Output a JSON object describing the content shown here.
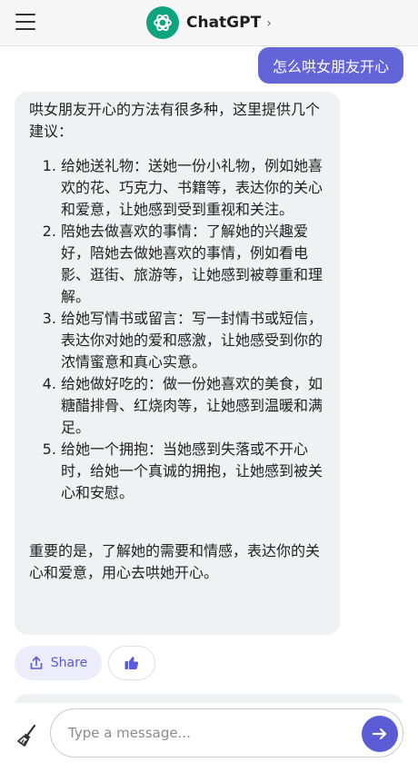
{
  "header": {
    "title": "ChatGPT",
    "chevron": "›",
    "menu_icon": "hamburger-menu-icon",
    "logo_icon": "openai-logo-icon",
    "logo_color": "#10a37f"
  },
  "user_message": "怎么哄女朋友开心",
  "assistant_message": {
    "intro": "哄女朋友开心的方法有很多种，这里提供几个建议：",
    "items": [
      "给她送礼物：送她一份小礼物，例如她喜欢的花、巧克力、书籍等，表达你的关心和爱意，让她感到受到重视和关注。",
      "陪她去做喜欢的事情：了解她的兴趣爱好，陪她去做她喜欢的事情，例如看电影、逛街、旅游等，让她感到被尊重和理解。",
      "给她写情书或留言：写一封情书或短信，表达你对她的爱和感激，让她感受到你的浓情蜜意和真心实意。",
      "给她做好吃的：做一份她喜欢的美食，如糖醋排骨、红烧肉等，让她感到温暖和满足。",
      "给她一个拥抱：当她感到失落或不开心时，给她一个真诚的拥抱，让她感到被关心和安慰。"
    ],
    "outro": "重要的是，了解她的需要和情感，表达你的关心和爱意，用心去哄她开心。"
  },
  "actions": {
    "share_label": "Share",
    "share_icon": "share-icon",
    "like_icon": "thumbs-up-icon"
  },
  "composer": {
    "placeholder": "Type a message...",
    "clear_icon": "broom-icon",
    "send_icon": "arrow-right-icon"
  },
  "colors": {
    "accent": "#5b5bd6",
    "user_bubble": "#6364d8",
    "assistant_bubble": "#f0f1f2"
  }
}
